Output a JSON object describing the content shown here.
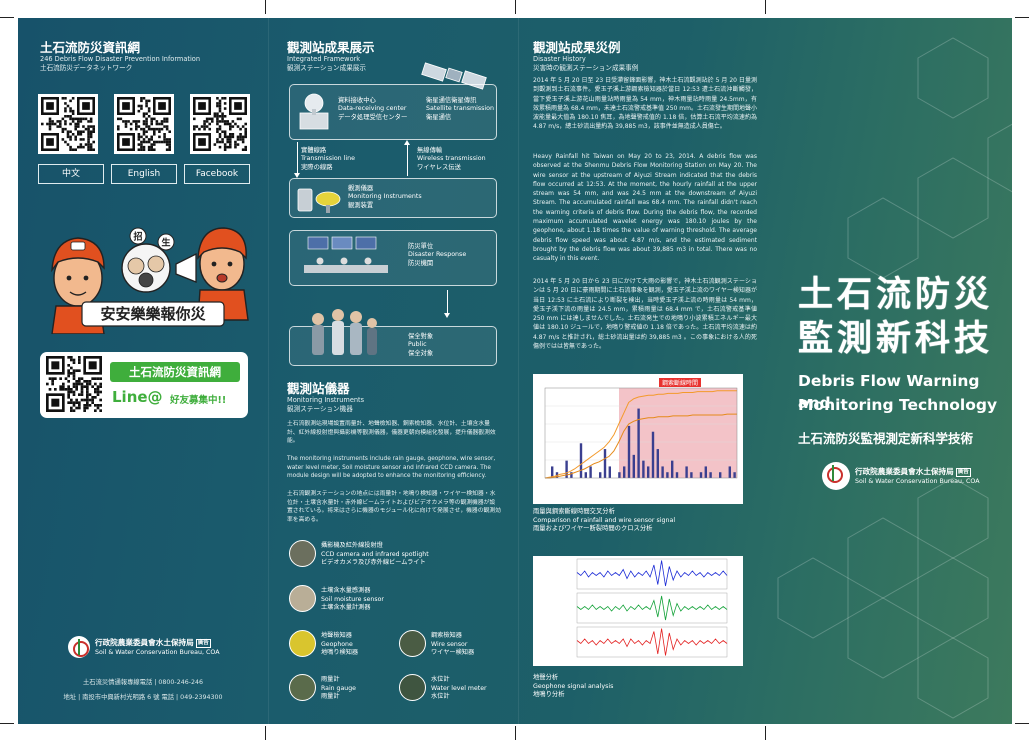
{
  "panel1": {
    "title": "土石流防災資訊網",
    "subtitle_en": "246 Debris Flow Disaster Prevention Information",
    "subtitle_jp": "土石流防災データネットワーク",
    "qr_labels": [
      "中文",
      "English",
      "Facebook"
    ],
    "slogan": "安安樂樂報你災",
    "mascot_glyphs": [
      "招",
      "生"
    ],
    "line_banner": "土石流防災資訊網",
    "line_at": "Line@",
    "line_friend": "好友募集中!!",
    "agency_zh": "行政院農業委員會水土保持局",
    "agency_badge": "廣告",
    "agency_en": "Soil & Water Conservation Bureau, COA",
    "hotline": "土石流災情通報專線電話  |  0800-246-246",
    "address": "地址  |  南投市中興新村光明路 6 號  電話  |  049-2394300"
  },
  "panel2": {
    "title": "觀測站成果展示",
    "subtitle_en": "Integrated Framework",
    "subtitle_jp": "観測ステーション成果展示",
    "data_center": [
      "資料接收中心",
      "Data-receiving center",
      "データ処理受信センター"
    ],
    "satellite": [
      "衛星通信衛星傳訊",
      "Satellite transmission",
      "衛星通信"
    ],
    "transmission": [
      "實體線路",
      "Transmission line",
      "実際の線路"
    ],
    "wireless": [
      "無線傳輸",
      "Wireless transmission",
      "ワイヤレス伝送"
    ],
    "instruments": [
      "觀測儀器",
      "Monitoring Instruments",
      "観測装置"
    ],
    "response": [
      "防災單位",
      "Disaster Response",
      "防災機関"
    ],
    "public": [
      "保全對象",
      "Public",
      "保全対象"
    ],
    "instr_title": "觀測站儀器",
    "instr_sub_en": "Monitoring Instruments",
    "instr_sub_jp": "観測ステーション機器",
    "instr_p_zh": "土石流觀測站現場設置雨量計、地聲檢知器、鋼索檢知器、水位計、土壤含水量計、紅外線投射燈與攝影機等觀測儀器，儀器更朝向模組化發展，提升儀器觀測效能。",
    "instr_p_en": "The monitoring instruments include rain gauge, geophone, wire sensor, water level meter, Soil moisture sensor and infrared CCD camera. The module design will be adopted to enhance the monitoring efficiency.",
    "instr_p_jp": "土石流観測ステーションの地点には雨量計・地鳴り検知器・ワイヤー検知器・水位計・土壌含水量計・赤外線ビームライトおよびビデオカメラ等の観測機器が設置されている。将来はさらに機器のモジュール化に向けて発展させ，機器の観測効率を高める。",
    "items": [
      {
        "zh": "攝影機及紅外線投射燈",
        "en": "CCD camera and infrared spotlight",
        "jp": "ビデオカメラ及び赤外線ビームライト"
      },
      {
        "zh": "土壤含水量感測器",
        "en": "Soil moisture sensor",
        "jp": "土壌含水量計測器"
      },
      {
        "zh": "地聲檢知器",
        "en": "Geophone",
        "jp": "地鳴り検知器"
      },
      {
        "zh": "鋼索檢知器",
        "en": "Wire sensor",
        "jp": "ワイヤー検知器"
      },
      {
        "zh": "雨量計",
        "en": "Rain gauge",
        "jp": "雨量計"
      },
      {
        "zh": "水位計",
        "en": "Water level meter",
        "jp": "水位計"
      }
    ]
  },
  "panel3": {
    "title": "觀測站成果災例",
    "subtitle_en": "Disaster History",
    "subtitle_jp": "災害時の観測ステーション成果事例",
    "p_zh": "2014 年 5 月 20 日至 23 日受滯留鋒面影響，神木土石流觀測站於 5 月 20 日量測到觀測到土石流事件。愛玉子溪上游鋼索檢知器於當日 12:53 遭土石流沖斷觸發，當下愛玉子溪上游花山雨量站時雨量為 54 mm，神木雨量站時雨量 24.5mm，有效累積雨量為 68.4 mm，未達土石流警戒基準值 250 mm。土石流發生期間地聲小波能量最大值為 180.10 焦耳，為地聲警戒值的 1.18 倍，估算土石流平均流速約為 4.87 m/s，總土砂流出量約為 39,885 m3，該事件並無造成人員傷亡。",
    "p_en": "Heavy Rainfall hit Taiwan on May 20 to 23, 2014. A debris flow was observed at the Shenmu Debris Flow Monitoring Station on May 20. The wire sensor at the upstream of  Aiyuzi Stream indicated that the debris flow occurred at 12:53. At the moment, the hourly rainfall at the upper stream was 54 mm, and was 24.5 mm at the downstream of  Aiyuzi Stream. The accumulated rainfall was 68.4 mm. The rainfall didn't reach the warning criteria of debris flow. During the debris flow, the recorded maximum accumulated wavelet energy was 180.10 joules by the geophone, about 1.18 times the value of warning threshold. The average debris flow speed was about 4.87 m/s, and the estimated sediment brought by the debris flow was about 39,885 m3 in total. There was no casualty in this event.",
    "p_jp": "2014 年 5 月 20 日から 23 日にかけて大雨の影響で，神木土石流観測ステーションは 5 月 20 日に豪雨期間に土石流事象を観測，愛玉子渓上流のワイヤー検知器が当日 12:53 に土石流により断裂を検出，当時愛玉子渓上流の時雨量は 54 mm，愛玉子渓下流の雨量は 24.5 mm，累積雨量は 68.4 mm で，土石流警戒基準値 250 mm には達しませんでした。土石流発生での地鳴り小波累積エネルギー最大値は 180.10 ジュールで，地鳴り警戒値の 1.18 倍であった。土石流平均流速は約 4.87 m/s と推計され，総土砂流出量は約 39,885 m3 。この事象における人的死傷例ではは皆無であった。",
    "cap1": [
      "雨量與鋼索斷線時間交叉分析",
      "Comparison of rainfall and wire sensor signal",
      "雨量およびワイヤー断裂時間のクロス分析"
    ],
    "chart_tag": "鋼索斷線時間",
    "cap2": [
      "地聲分析",
      "Geophone signal analysis",
      "地鳴り分析"
    ]
  },
  "panel4": {
    "title_zh_1": "土石流防災",
    "title_zh_2": "監測新科技",
    "title_en_1": "Debris Flow Warning and",
    "title_en_2": "Monitoring Technology",
    "title_jp": "土石流防災監視測定新科学技術"
  },
  "colors": {
    "background": "#1b5a6b",
    "line_green": "#3fae3c",
    "chart_orange": "#f39a2b",
    "chart_pink": "#f3c3c8"
  },
  "chart_data": [
    {
      "type": "bar",
      "title": "",
      "tag": "鋼索斷線時間",
      "series": [
        {
          "values": [
            0,
            2,
            1,
            0,
            3,
            1,
            0,
            6,
            1,
            2,
            0,
            1,
            5,
            2,
            0,
            1,
            2,
            9,
            4,
            12,
            3,
            2,
            8,
            5,
            2,
            1,
            3,
            1,
            0,
            2,
            1,
            0,
            1,
            2,
            1,
            0,
            1,
            0,
            2,
            1
          ]
        }
      ],
      "grid": true
    },
    {
      "type": "line",
      "title": "",
      "series": [
        {
          "values": [
            0,
            1,
            2,
            4,
            5,
            7,
            10,
            14,
            18,
            22,
            26,
            30,
            34,
            40,
            48,
            60,
            72,
            84,
            88,
            90,
            91,
            92,
            92,
            93,
            93,
            94,
            94,
            94,
            95,
            95,
            95,
            96,
            96,
            96,
            96,
            97,
            97,
            97,
            97,
            97
          ]
        },
        {
          "values": [
            0,
            0,
            1,
            2,
            3,
            4,
            6,
            8,
            10,
            13,
            16,
            18,
            21,
            24,
            30,
            40,
            52,
            60,
            63,
            65,
            66,
            67,
            67,
            68,
            68,
            68,
            69,
            69,
            69,
            69,
            70,
            70,
            70,
            70,
            70,
            70,
            70,
            71,
            71,
            71
          ]
        }
      ],
      "grid": true
    },
    {
      "type": "line",
      "title": "",
      "series": [
        {
          "name": "",
          "values": [
            1,
            -1,
            2,
            -2,
            1,
            -1,
            1,
            -2,
            2,
            -1,
            1,
            -1,
            3,
            -3,
            2,
            -2,
            1,
            -1,
            2,
            -2,
            6,
            -7,
            9,
            -8,
            5,
            -4,
            2,
            -2,
            1,
            -1,
            2,
            -1,
            1,
            -2,
            1,
            -1,
            1,
            -1,
            2,
            -1
          ]
        },
        {
          "name": "",
          "values": [
            1,
            -1,
            1,
            -1,
            2,
            -1,
            1,
            -1,
            1,
            -2,
            1,
            -1,
            2,
            -2,
            1,
            -1,
            2,
            -1,
            1,
            -1,
            5,
            -6,
            8,
            -8,
            6,
            -5,
            3,
            -2,
            1,
            -1,
            1,
            -1,
            1,
            -1,
            2,
            -1,
            1,
            -1,
            1,
            -1
          ]
        },
        {
          "name": "",
          "values": [
            1,
            -1,
            2,
            -1,
            1,
            -2,
            1,
            -1,
            2,
            -1,
            1,
            -1,
            2,
            -3,
            2,
            -1,
            1,
            -2,
            1,
            -1,
            7,
            -8,
            9,
            -9,
            6,
            -5,
            2,
            -2,
            1,
            -1,
            1,
            -2,
            1,
            -1,
            1,
            -1,
            2,
            -1,
            1,
            -1
          ]
        }
      ],
      "grid": true
    }
  ]
}
